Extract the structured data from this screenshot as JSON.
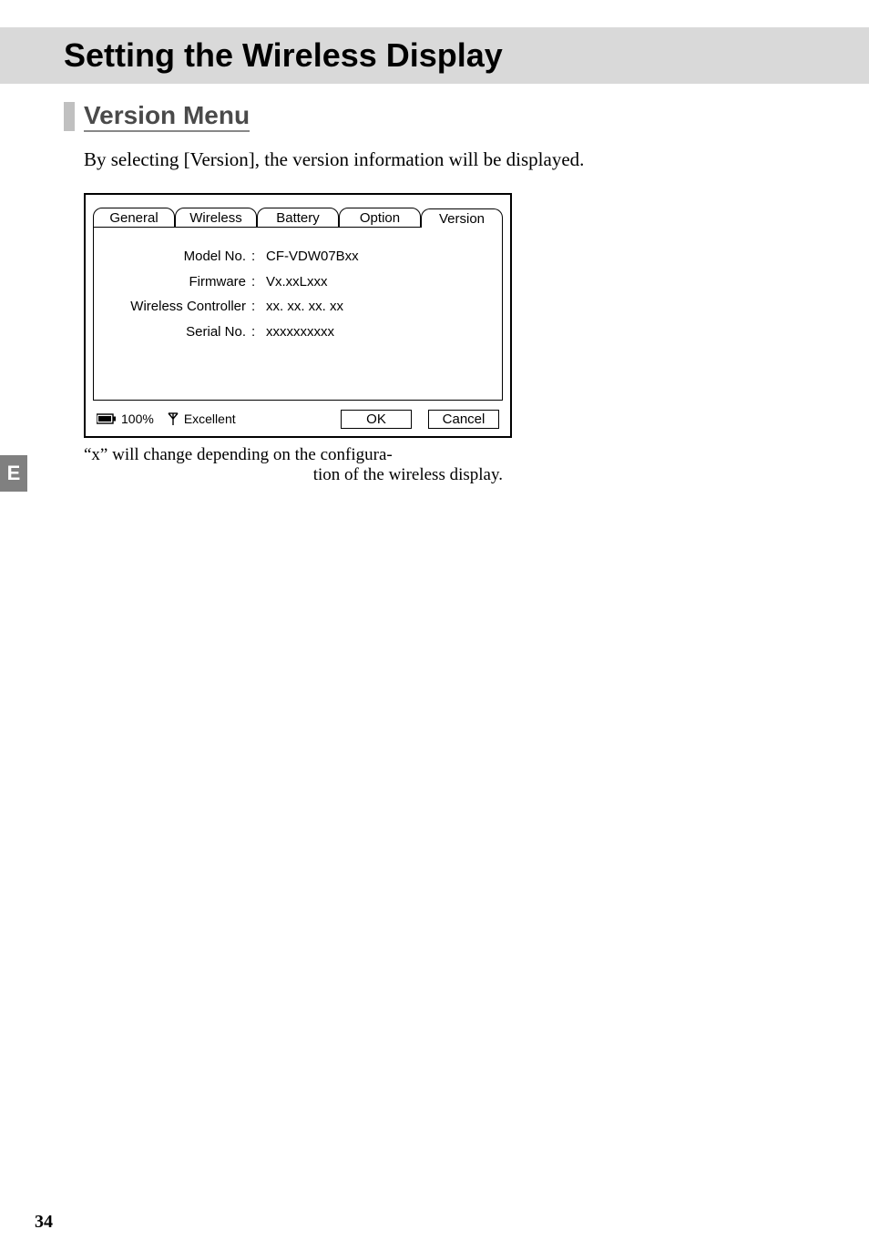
{
  "page": {
    "title": "Setting the Wireless Display",
    "section_heading": "Version Menu",
    "intro_text": "By selecting [Version], the version information will be displayed.",
    "caption_line1": "“x” will change depending on the configura-",
    "caption_line2": "tion of the wireless display.",
    "side_tab": "E",
    "page_number": "34"
  },
  "dialog": {
    "tabs": {
      "general": "General",
      "wireless": "Wireless",
      "battery": "Battery",
      "option": "Option",
      "version": "Version"
    },
    "rows": [
      {
        "label": "Model No.",
        "value": "CF-VDW07Bxx"
      },
      {
        "label": "Firmware",
        "value": "Vx.xxLxxx"
      },
      {
        "label": "Wireless Controller",
        "value": "xx. xx. xx. xx"
      },
      {
        "label": "Serial No.",
        "value": "xxxxxxxxxx"
      }
    ],
    "status": {
      "battery_pct": "100%",
      "signal": "Excellent"
    },
    "buttons": {
      "ok": "OK",
      "cancel": "Cancel"
    }
  }
}
